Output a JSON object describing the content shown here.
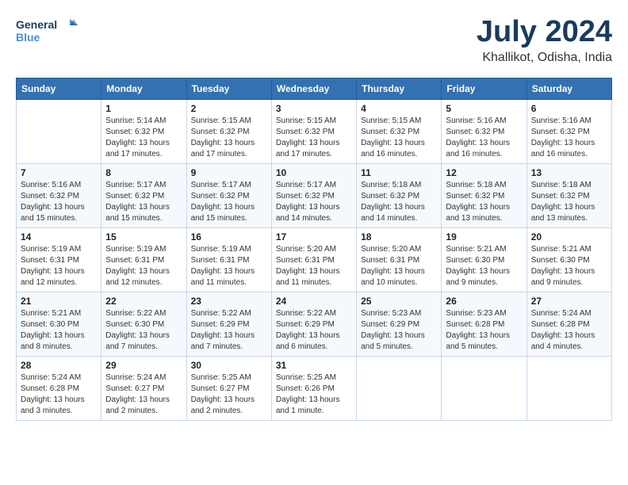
{
  "logo": {
    "line1": "General",
    "line2": "Blue"
  },
  "title": {
    "month": "July 2024",
    "location": "Khallikot, Odisha, India"
  },
  "weekdays": [
    "Sunday",
    "Monday",
    "Tuesday",
    "Wednesday",
    "Thursday",
    "Friday",
    "Saturday"
  ],
  "weeks": [
    [
      {
        "day": null
      },
      {
        "day": 1,
        "sunrise": "5:14 AM",
        "sunset": "6:32 PM",
        "daylight": "13 hours and 17 minutes."
      },
      {
        "day": 2,
        "sunrise": "5:15 AM",
        "sunset": "6:32 PM",
        "daylight": "13 hours and 17 minutes."
      },
      {
        "day": 3,
        "sunrise": "5:15 AM",
        "sunset": "6:32 PM",
        "daylight": "13 hours and 17 minutes."
      },
      {
        "day": 4,
        "sunrise": "5:15 AM",
        "sunset": "6:32 PM",
        "daylight": "13 hours and 16 minutes."
      },
      {
        "day": 5,
        "sunrise": "5:16 AM",
        "sunset": "6:32 PM",
        "daylight": "13 hours and 16 minutes."
      },
      {
        "day": 6,
        "sunrise": "5:16 AM",
        "sunset": "6:32 PM",
        "daylight": "13 hours and 16 minutes."
      }
    ],
    [
      {
        "day": 7,
        "sunrise": "5:16 AM",
        "sunset": "6:32 PM",
        "daylight": "13 hours and 15 minutes."
      },
      {
        "day": 8,
        "sunrise": "5:17 AM",
        "sunset": "6:32 PM",
        "daylight": "13 hours and 15 minutes."
      },
      {
        "day": 9,
        "sunrise": "5:17 AM",
        "sunset": "6:32 PM",
        "daylight": "13 hours and 15 minutes."
      },
      {
        "day": 10,
        "sunrise": "5:17 AM",
        "sunset": "6:32 PM",
        "daylight": "13 hours and 14 minutes."
      },
      {
        "day": 11,
        "sunrise": "5:18 AM",
        "sunset": "6:32 PM",
        "daylight": "13 hours and 14 minutes."
      },
      {
        "day": 12,
        "sunrise": "5:18 AM",
        "sunset": "6:32 PM",
        "daylight": "13 hours and 13 minutes."
      },
      {
        "day": 13,
        "sunrise": "5:18 AM",
        "sunset": "6:32 PM",
        "daylight": "13 hours and 13 minutes."
      }
    ],
    [
      {
        "day": 14,
        "sunrise": "5:19 AM",
        "sunset": "6:31 PM",
        "daylight": "13 hours and 12 minutes."
      },
      {
        "day": 15,
        "sunrise": "5:19 AM",
        "sunset": "6:31 PM",
        "daylight": "13 hours and 12 minutes."
      },
      {
        "day": 16,
        "sunrise": "5:19 AM",
        "sunset": "6:31 PM",
        "daylight": "13 hours and 11 minutes."
      },
      {
        "day": 17,
        "sunrise": "5:20 AM",
        "sunset": "6:31 PM",
        "daylight": "13 hours and 11 minutes."
      },
      {
        "day": 18,
        "sunrise": "5:20 AM",
        "sunset": "6:31 PM",
        "daylight": "13 hours and 10 minutes."
      },
      {
        "day": 19,
        "sunrise": "5:21 AM",
        "sunset": "6:30 PM",
        "daylight": "13 hours and 9 minutes."
      },
      {
        "day": 20,
        "sunrise": "5:21 AM",
        "sunset": "6:30 PM",
        "daylight": "13 hours and 9 minutes."
      }
    ],
    [
      {
        "day": 21,
        "sunrise": "5:21 AM",
        "sunset": "6:30 PM",
        "daylight": "13 hours and 8 minutes."
      },
      {
        "day": 22,
        "sunrise": "5:22 AM",
        "sunset": "6:30 PM",
        "daylight": "13 hours and 7 minutes."
      },
      {
        "day": 23,
        "sunrise": "5:22 AM",
        "sunset": "6:29 PM",
        "daylight": "13 hours and 7 minutes."
      },
      {
        "day": 24,
        "sunrise": "5:22 AM",
        "sunset": "6:29 PM",
        "daylight": "13 hours and 6 minutes."
      },
      {
        "day": 25,
        "sunrise": "5:23 AM",
        "sunset": "6:29 PM",
        "daylight": "13 hours and 5 minutes."
      },
      {
        "day": 26,
        "sunrise": "5:23 AM",
        "sunset": "6:28 PM",
        "daylight": "13 hours and 5 minutes."
      },
      {
        "day": 27,
        "sunrise": "5:24 AM",
        "sunset": "6:28 PM",
        "daylight": "13 hours and 4 minutes."
      }
    ],
    [
      {
        "day": 28,
        "sunrise": "5:24 AM",
        "sunset": "6:28 PM",
        "daylight": "13 hours and 3 minutes."
      },
      {
        "day": 29,
        "sunrise": "5:24 AM",
        "sunset": "6:27 PM",
        "daylight": "13 hours and 2 minutes."
      },
      {
        "day": 30,
        "sunrise": "5:25 AM",
        "sunset": "6:27 PM",
        "daylight": "13 hours and 2 minutes."
      },
      {
        "day": 31,
        "sunrise": "5:25 AM",
        "sunset": "6:26 PM",
        "daylight": "13 hours and 1 minute."
      },
      {
        "day": null
      },
      {
        "day": null
      },
      {
        "day": null
      }
    ]
  ],
  "labels": {
    "sunrise_prefix": "Sunrise: ",
    "sunset_prefix": "Sunset: ",
    "daylight_label": "Daylight hours"
  }
}
